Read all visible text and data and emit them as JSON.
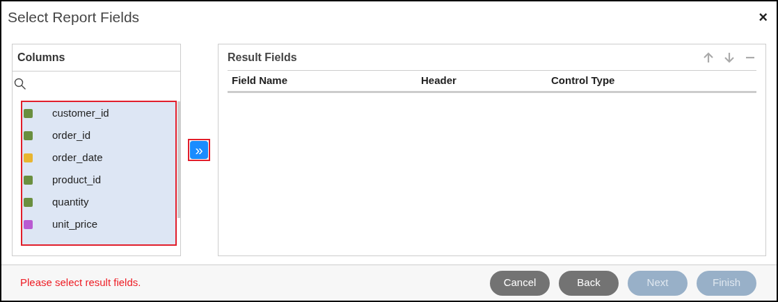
{
  "window": {
    "title": "Select Report Fields",
    "close": "×"
  },
  "columns_panel": {
    "title": "Columns",
    "items": [
      {
        "label": "customer_id",
        "color": "#6a8f3f",
        "selected": true
      },
      {
        "label": "order_id",
        "color": "#6a8f3f",
        "selected": true
      },
      {
        "label": "order_date",
        "color": "#e8b530",
        "selected": true
      },
      {
        "label": "product_id",
        "color": "#6a8f3f",
        "selected": true
      },
      {
        "label": "quantity",
        "color": "#6a8f3f",
        "selected": true
      },
      {
        "label": "unit_price",
        "color": "#b95ad1",
        "selected": true
      }
    ]
  },
  "transfer_button": {
    "label": "»"
  },
  "result_panel": {
    "title": "Result Fields",
    "columns": [
      "Field Name",
      "Header",
      "Control Type"
    ]
  },
  "footer": {
    "message": "Please select result fields.",
    "buttons": [
      {
        "label": "Cancel",
        "disabled": false
      },
      {
        "label": "Back",
        "disabled": false
      },
      {
        "label": "Next",
        "disabled": true
      },
      {
        "label": "Finish",
        "disabled": true
      }
    ]
  }
}
